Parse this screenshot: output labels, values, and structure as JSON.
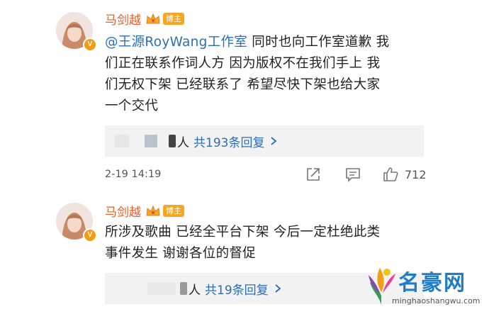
{
  "comments": [
    {
      "author": "马剑越",
      "badge": "博主",
      "mention": "@王源RoyWang工作室",
      "lines": [
        "同时也向工作室道歉 我",
        "们正在联系作词人方 因为版权不在我们手上 我",
        "们无权下架 已经联系了 希望尽快下架也给大家",
        "一个交代"
      ],
      "reply_suffix": "人",
      "reply_link": "共193条回复",
      "time": "2-19 14:19",
      "likes": "712"
    },
    {
      "author": "马剑越",
      "badge": "博主",
      "lines": [
        "所涉及歌曲 已经全平台下架 今后一定杜绝此类",
        "事件发生 谢谢各位的督促"
      ],
      "reply_suffix": "人",
      "reply_link": "共19条回复"
    }
  ],
  "watermark": {
    "title": "名豪网",
    "url": "minghaoshangwu.com"
  },
  "colors": {
    "name": "#e8602c",
    "link": "#2a6ebb",
    "badge": "#f5a623"
  }
}
